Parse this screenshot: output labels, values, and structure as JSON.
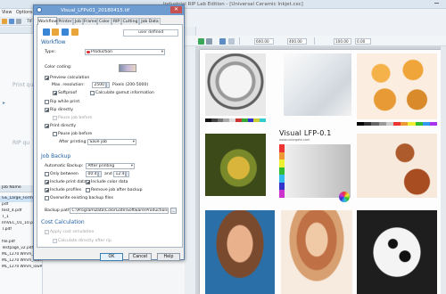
{
  "app": {
    "title": "Industrial RIP Lab Edition - [Universal Ceramic Inkjet.cxc]",
    "menu": [
      "View",
      "Options"
    ],
    "toolbar_printer": "TIFF RIP File",
    "left_pane": {
      "print_queue_label": "Print qu",
      "rip_queue_label": "RIP qu",
      "jobs": [
        "Job Name",
        "GE_Large_Format_I",
        "pdf",
        "test_4.pdf",
        "T_1",
        "ImVEC_01_10.pdf",
        "T.pdf"
      ],
      "files": [
        "file.pdf",
        "Testpage_v2.pdf",
        "ML_1270 Wmm_lowRI.pdf",
        "ML_1270 Wmm_lowRI.pdf",
        "ML_1270 Wmm_lowRI.pdf"
      ]
    },
    "mid_rows": [
      {
        "size": "641 x 154",
        "value": "$30.0 mb"
      },
      {
        "size": "841 x 594",
        "value": "$14.5 mb"
      },
      {
        "size": "841 x 594",
        "value": "$14.5 mb"
      },
      {
        "size": "841 x 594",
        "value": "$14.5 mb"
      }
    ],
    "preview_toolbar": {
      "width_value": "600.00",
      "height_value": "400.00",
      "zoom_value": "100.00",
      "x_value": "0.00"
    },
    "preview": {
      "title": "Visual LFP-0.1",
      "subtitle": "www.colorgate.com"
    }
  },
  "dialog": {
    "title": "Visual_LFPv01_20180415.tif",
    "close_label": "✕",
    "tabs": [
      "Workflow",
      "Printer",
      "Job",
      "Frame",
      "Color",
      "RIP",
      "Cutting",
      "Job Data"
    ],
    "user_defined": "user defined",
    "workflow": {
      "heading": "Workflow",
      "type_label": "Type:",
      "type_value": "Production",
      "color_coding_label": "Color coding:",
      "preview_calc": "Preview calculation",
      "max_res_label": "Max. resolution:",
      "max_res_value": "2500",
      "max_res_unit": "Pixels (200-5000)",
      "softproof": "Softproof",
      "calc_gamut": "Calculate gamut information",
      "rip_while_print": "Rip while print",
      "rip_directly": "Rip directly",
      "pause_ripped": "Pause job before",
      "print_directly": "Print directly",
      "pause_print": "Pause job before",
      "after_printing_label": "After printing:",
      "after_printing_value": "Save job"
    },
    "backup": {
      "heading": "Job Backup",
      "auto_backup_label": "Automatic Backup:",
      "auto_backup_value": "After printing",
      "only_between": "Only between",
      "time_from": "00:49",
      "and_label": "and",
      "time_to": "12:40",
      "include_print_data": "Include print data",
      "include_color_data": "Include color data",
      "include_profiles": "Include profiles",
      "remove_after": "Remove job after backup",
      "overwrite": "Overwrite existing backup files",
      "backup_path_label": "Backup path:",
      "backup_path_value": "C:\\ProgramData\\ColorGate\\Software\\Productionser"
    },
    "cost": {
      "heading": "Cost Calculation",
      "apply_cost": "Apply cost simulation",
      "calc_after_rip": "Calculate directly after rip"
    },
    "buttons": {
      "ok": "OK",
      "cancel": "Cancel",
      "help": "Help"
    }
  }
}
